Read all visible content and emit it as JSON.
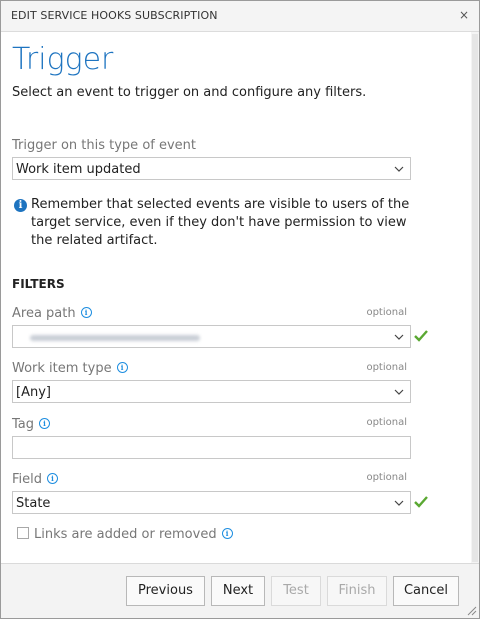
{
  "dialog": {
    "title": "EDIT SERVICE HOOKS SUBSCRIPTION",
    "close_glyph": "×"
  },
  "page": {
    "heading": "Trigger",
    "subheading": "Select an event to trigger on and configure any filters."
  },
  "trigger": {
    "label": "Trigger on this type of event",
    "selected": "Work item updated"
  },
  "notice": {
    "icon": "info-icon",
    "text": "Remember that selected events are visible to users of the target service, even if they don't have permission to view the related artifact."
  },
  "filters": {
    "heading": "FILTERS",
    "optional_label": "optional",
    "area_path": {
      "label": "Area path",
      "value_obscured": true,
      "valid": true
    },
    "work_item_type": {
      "label": "Work item type",
      "selected": "[Any]"
    },
    "tag": {
      "label": "Tag",
      "value": ""
    },
    "field": {
      "label": "Field",
      "selected": "State",
      "valid": true
    },
    "links_checkbox": {
      "label": "Links are added or removed",
      "checked": false
    }
  },
  "buttons": {
    "previous": "Previous",
    "next": "Next",
    "test": "Test",
    "finish": "Finish",
    "cancel": "Cancel"
  },
  "colors": {
    "accent": "#1e74c0",
    "info": "#1e8ee0",
    "valid": "#5aa832"
  }
}
